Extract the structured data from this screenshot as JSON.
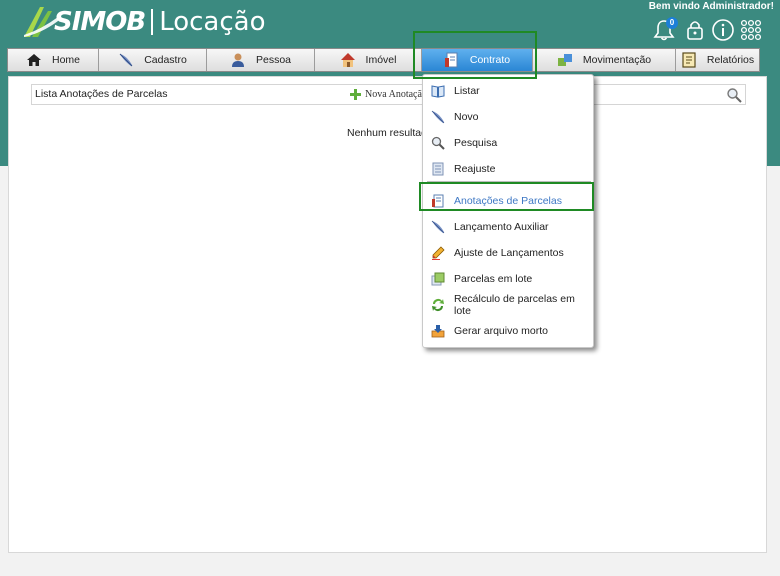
{
  "app": {
    "brand": "SIMOB",
    "product": "Locação",
    "welcome": "Bem vindo Administrador!",
    "notification_count": "0"
  },
  "nav": [
    {
      "label": "Home",
      "icon": "home-icon"
    },
    {
      "label": "Cadastro",
      "icon": "feather-icon"
    },
    {
      "label": "Pessoa",
      "icon": "person-icon"
    },
    {
      "label": "Imóvel",
      "icon": "house-icon"
    },
    {
      "label": "Contrato",
      "icon": "contract-icon"
    },
    {
      "label": "Movimentação",
      "icon": "transfer-icon"
    },
    {
      "label": "Relatórios",
      "icon": "report-icon"
    }
  ],
  "main": {
    "list_title": "Lista Anotações de Parcelas",
    "new_link": "Nova Anotação",
    "empty_message": "Nenhum resultado"
  },
  "contrato_menu": {
    "items": [
      {
        "label": "Listar",
        "icon": "book-icon"
      },
      {
        "label": "Novo",
        "icon": "feather-icon"
      },
      {
        "label": "Pesquisa",
        "icon": "magnifier-icon"
      },
      {
        "label": "Reajuste",
        "icon": "document-icon"
      },
      {
        "label": "Anotações de Parcelas",
        "icon": "notes-icon"
      },
      {
        "label": "Lançamento Auxiliar",
        "icon": "feather-icon"
      },
      {
        "label": "Ajuste de Lançamentos",
        "icon": "pencil-icon"
      },
      {
        "label": "Parcelas em lote",
        "icon": "batch-icon"
      },
      {
        "label": "Recálculo de parcelas em lote",
        "icon": "refresh-icon"
      },
      {
        "label": "Gerar arquivo morto",
        "icon": "download-icon"
      }
    ]
  },
  "colors": {
    "header_bg": "#3b8a80",
    "active_tab": "#2a86d4",
    "highlight_box": "#1f8a24",
    "active_menu_text": "#3e78c4"
  }
}
